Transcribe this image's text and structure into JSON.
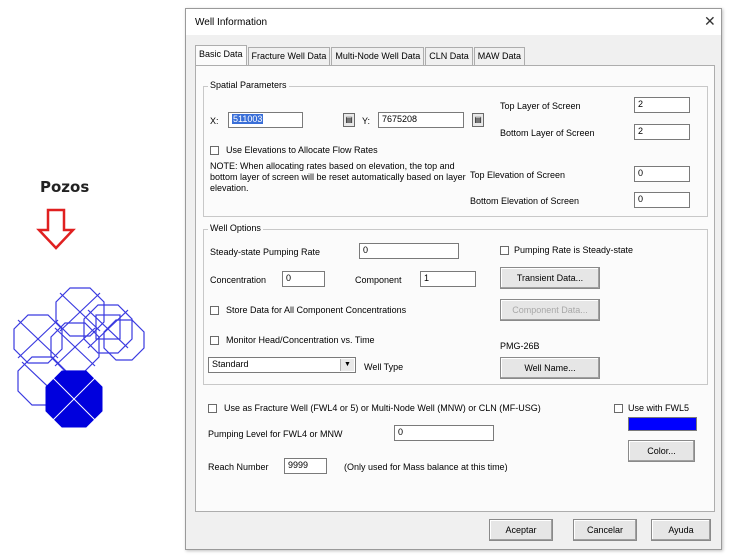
{
  "annotation": {
    "label": "Pozos"
  },
  "dialog": {
    "title": "Well Information",
    "close_glyph": "✕",
    "tabs": [
      "Basic Data",
      "Fracture Well Data",
      "Multi-Node Well Data",
      "CLN Data",
      "MAW Data"
    ],
    "spatial": {
      "group_label": "Spatial Parameters",
      "x_label": "X:",
      "x_value": "511003",
      "y_label": "Y:",
      "y_value": "7675208",
      "spin_glyph": "▤",
      "top_layer_label": "Top Layer of Screen",
      "top_layer_value": "2",
      "bottom_layer_label": "Bottom Layer of Screen",
      "bottom_layer_value": "2",
      "use_elev_label": "Use Elevations to Allocate Flow Rates",
      "note": "NOTE: When allocating rates based on elevation, the top and bottom layer of screen will be reset automatically based on layer elevation.",
      "top_elev_label": "Top Elevation of Screen",
      "top_elev_value": "0",
      "bottom_elev_label": "Bottom Elevation of Screen",
      "bottom_elev_value": "0"
    },
    "options": {
      "group_label": "Well Options",
      "pump_rate_label": "Steady-state Pumping Rate",
      "pump_rate_value": "0",
      "pump_steady_label": "Pumping Rate is Steady-state",
      "conc_label": "Concentration",
      "conc_value": "0",
      "component_label": "Component",
      "component_value": "1",
      "transient_btn": "Transient Data...",
      "store_label": "Store Data for All Component Concentrations",
      "component_data_btn": "Component Data...",
      "monitor_label": "Monitor Head/Concentration vs. Time",
      "well_id": "PMG-26B",
      "well_type_value": "Standard",
      "well_type_label": "Well Type",
      "well_name_btn": "Well Name..."
    },
    "fracture_label": "Use as Fracture Well (FWL4 or 5) or Multi-Node Well (MNW) or CLN (MF-USG)",
    "use_fwl5_label": "Use with FWL5",
    "pump_level_label": "Pumping Level for FWL4 or MNW",
    "pump_level_value": "0",
    "color_btn": "Color...",
    "reach_label": "Reach Number",
    "reach_value": "9999",
    "reach_note": "(Only used for Mass balance at this time)",
    "accept_btn": "Aceptar",
    "cancel_btn": "Cancelar",
    "help_btn": "Ayuda",
    "colors": {
      "swatch": "#0000ff",
      "highlight": "#3a6fd8"
    }
  }
}
